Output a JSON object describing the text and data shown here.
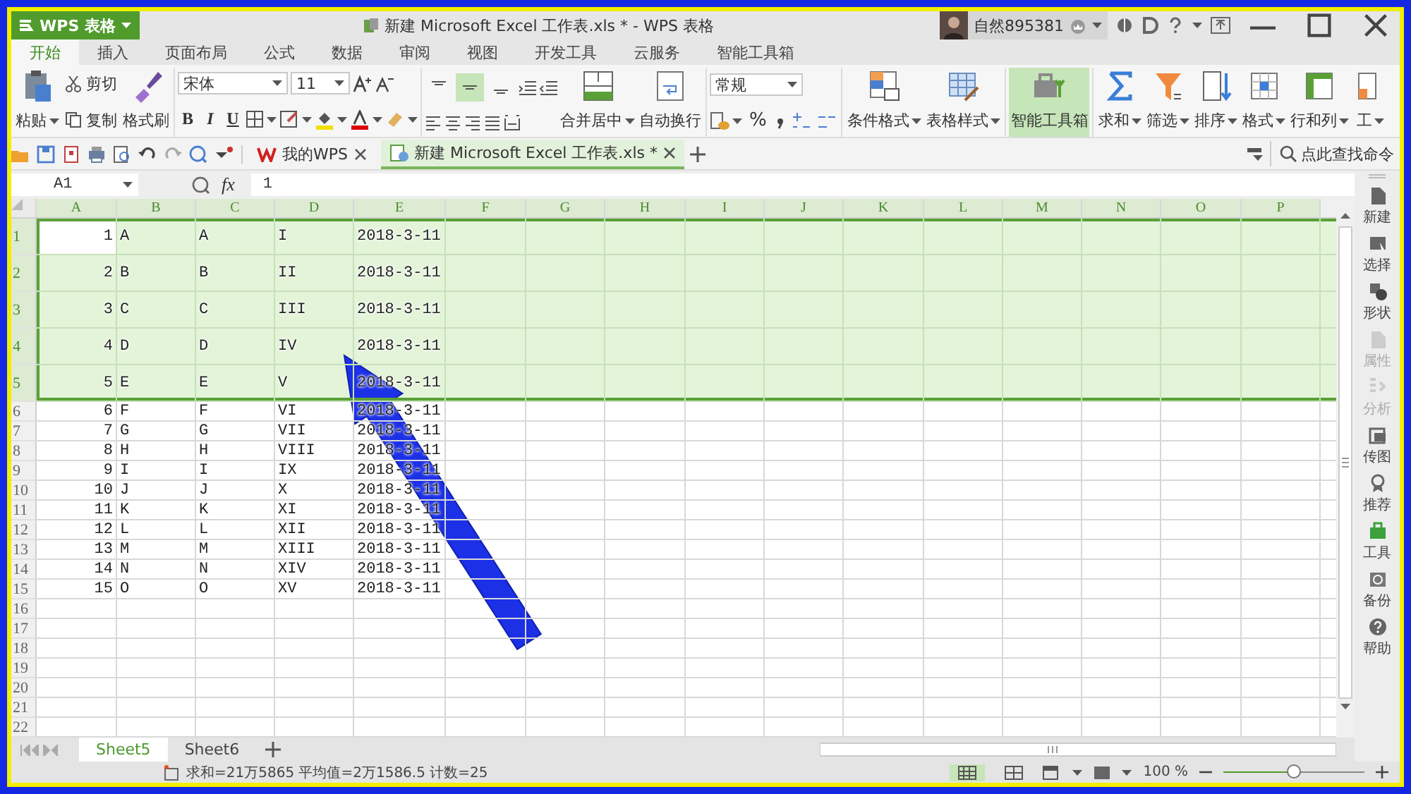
{
  "app_button": {
    "label": "WPS 表格"
  },
  "window": {
    "title": "新建 Microsoft Excel 工作表.xls * - WPS 表格"
  },
  "user": {
    "name": "自然895381"
  },
  "menu_tabs": [
    {
      "label": "开始",
      "selected": true
    },
    {
      "label": "插入",
      "selected": false
    },
    {
      "label": "页面布局",
      "selected": false
    },
    {
      "label": "公式",
      "selected": false
    },
    {
      "label": "数据",
      "selected": false
    },
    {
      "label": "审阅",
      "selected": false
    },
    {
      "label": "视图",
      "selected": false
    },
    {
      "label": "开发工具",
      "selected": false
    },
    {
      "label": "云服务",
      "selected": false
    },
    {
      "label": "智能工具箱",
      "selected": false
    }
  ],
  "ribbon": {
    "clipboard": {
      "paste": "粘贴",
      "cut": "剪切",
      "copy": "复制",
      "format_painter": "格式刷"
    },
    "font": {
      "name": "宋体",
      "size": "11",
      "styles": [
        "B",
        "I",
        "U"
      ]
    },
    "alignment": {
      "vertical": [
        {
          "selected": false
        },
        {
          "selected": true
        },
        {
          "selected": false
        }
      ],
      "merge": "合并居中",
      "wrap": "自动换行"
    },
    "number": {
      "format": "常规",
      "percent": "%"
    },
    "styles": [
      "条件格式",
      "表格样式"
    ],
    "toolbox": {
      "label": "智能工具箱",
      "selected": true
    },
    "commands": [
      "求和",
      "筛选",
      "排序",
      "格式",
      "行和列",
      "工"
    ]
  },
  "doc_tabs": [
    {
      "label": "我的WPS",
      "selected": false
    },
    {
      "label": "新建 Microsoft Excel 工作表.xls *",
      "selected": true
    }
  ],
  "command_search": {
    "placeholder": "点此查找命令"
  },
  "formula_bar": {
    "name_box": "A1",
    "fx": "fx",
    "value": "1"
  },
  "columns": [
    {
      "label": "A",
      "selected": true
    },
    {
      "label": "B",
      "selected": true
    },
    {
      "label": "C",
      "selected": true
    },
    {
      "label": "D",
      "selected": true
    },
    {
      "label": "E",
      "selected": true
    },
    {
      "label": "F",
      "selected": true
    },
    {
      "label": "G",
      "selected": true
    },
    {
      "label": "H",
      "selected": true
    },
    {
      "label": "I",
      "selected": true
    },
    {
      "label": "J",
      "selected": true
    },
    {
      "label": "K",
      "selected": true
    },
    {
      "label": "L",
      "selected": true
    },
    {
      "label": "M",
      "selected": true
    },
    {
      "label": "N",
      "selected": true
    },
    {
      "label": "O",
      "selected": true
    },
    {
      "label": "P",
      "selected": true
    }
  ],
  "rows": [
    {
      "number": "1",
      "kind": "tall",
      "selected": true,
      "active": true,
      "cells": [
        "1",
        "A",
        "A",
        "I",
        "2018-3-11"
      ]
    },
    {
      "number": "2",
      "kind": "tall",
      "selected": true,
      "active": false,
      "cells": [
        "2",
        "B",
        "B",
        "II",
        "2018-3-11"
      ]
    },
    {
      "number": "3",
      "kind": "tall",
      "selected": true,
      "active": false,
      "cells": [
        "3",
        "C",
        "C",
        "III",
        "2018-3-11"
      ]
    },
    {
      "number": "4",
      "kind": "tall",
      "selected": true,
      "active": false,
      "cells": [
        "4",
        "D",
        "D",
        "IV",
        "2018-3-11"
      ]
    },
    {
      "number": "5",
      "kind": "tall",
      "selected": true,
      "active": false,
      "cells": [
        "5",
        "E",
        "E",
        "V",
        "2018-3-11"
      ]
    },
    {
      "number": "6",
      "kind": "normal",
      "selected": false,
      "cells": [
        "6",
        "F",
        "F",
        "VI",
        "2018-3-11"
      ]
    },
    {
      "number": "7",
      "kind": "normal",
      "selected": false,
      "cells": [
        "7",
        "G",
        "G",
        "VII",
        "2018-3-11"
      ]
    },
    {
      "number": "8",
      "kind": "normal",
      "selected": false,
      "cells": [
        "8",
        "H",
        "H",
        "VIII",
        "2018-3-11"
      ]
    },
    {
      "number": "9",
      "kind": "normal",
      "selected": false,
      "cells": [
        "9",
        "I",
        "I",
        "IX",
        "2018-3-11"
      ]
    },
    {
      "number": "10",
      "kind": "normal",
      "selected": false,
      "cells": [
        "10",
        "J",
        "J",
        "X",
        "2018-3-11"
      ]
    },
    {
      "number": "11",
      "kind": "normal",
      "selected": false,
      "cells": [
        "11",
        "K",
        "K",
        "XI",
        "2018-3-11"
      ]
    },
    {
      "number": "12",
      "kind": "normal",
      "selected": false,
      "cells": [
        "12",
        "L",
        "L",
        "XII",
        "2018-3-11"
      ]
    },
    {
      "number": "13",
      "kind": "normal",
      "selected": false,
      "cells": [
        "13",
        "M",
        "M",
        "XIII",
        "2018-3-11"
      ]
    },
    {
      "number": "14",
      "kind": "normal",
      "selected": false,
      "cells": [
        "14",
        "N",
        "N",
        "XIV",
        "2018-3-11"
      ]
    },
    {
      "number": "15",
      "kind": "normal",
      "selected": false,
      "cells": [
        "15",
        "O",
        "O",
        "XV",
        "2018-3-11"
      ]
    },
    {
      "number": "16",
      "kind": "normal",
      "selected": false
    },
    {
      "number": "17",
      "kind": "normal",
      "selected": false
    },
    {
      "number": "18",
      "kind": "normal",
      "selected": false
    },
    {
      "number": "19",
      "kind": "normal",
      "selected": false
    },
    {
      "number": "20",
      "kind": "normal",
      "selected": false
    },
    {
      "number": "21",
      "kind": "normal",
      "selected": false
    },
    {
      "number": "22",
      "kind": "normal",
      "selected": false
    }
  ],
  "sheet_tabs": [
    {
      "label": "Sheet5",
      "selected": true
    },
    {
      "label": "Sheet6",
      "selected": false
    }
  ],
  "sidebar": [
    {
      "label": "新建",
      "disabled": false
    },
    {
      "label": "选择",
      "disabled": false
    },
    {
      "label": "形状",
      "disabled": false
    },
    {
      "label": "属性",
      "disabled": true
    },
    {
      "label": "分析",
      "disabled": true
    },
    {
      "label": "传图",
      "disabled": false
    },
    {
      "label": "推荐",
      "disabled": false
    },
    {
      "label": "工具",
      "disabled": false
    },
    {
      "label": "备份",
      "disabled": false
    },
    {
      "label": "帮助",
      "disabled": false
    }
  ],
  "status_bar": {
    "summary": "求和=21万5865  平均值=2万1586.5  计数=25",
    "zoom": "100 %",
    "zoom_slider": {
      "level": 0.5
    }
  },
  "annotation": {
    "kind": "arrow"
  }
}
